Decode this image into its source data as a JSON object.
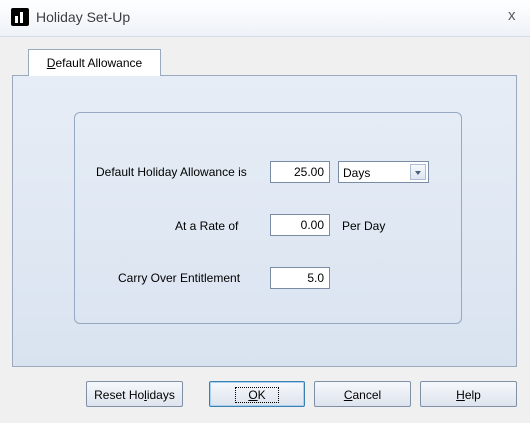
{
  "window": {
    "title": "Holiday Set-Up",
    "close_glyph": "x"
  },
  "tab": {
    "label_mnemonic": "D",
    "label_rest": "efault Allowance"
  },
  "form": {
    "allowance_label": "Default Holiday Allowance is",
    "allowance_value": "25.00",
    "unit_selected": "Days",
    "rate_label": "At a Rate of",
    "rate_value": "0.00",
    "rate_suffix": "Per Day",
    "carry_label": "Carry Over Entitlement",
    "carry_value": "5.0"
  },
  "buttons": {
    "reset_pre": "Reset Ho",
    "reset_mn": "l",
    "reset_post": "idays",
    "ok_mn": "O",
    "ok_post": "K",
    "cancel_mn": "C",
    "cancel_post": "ancel",
    "help_mn": "H",
    "help_post": "elp"
  },
  "icons": {
    "app": "app-chart-icon",
    "close": "close-icon",
    "dropdown": "chevron-down-icon"
  }
}
